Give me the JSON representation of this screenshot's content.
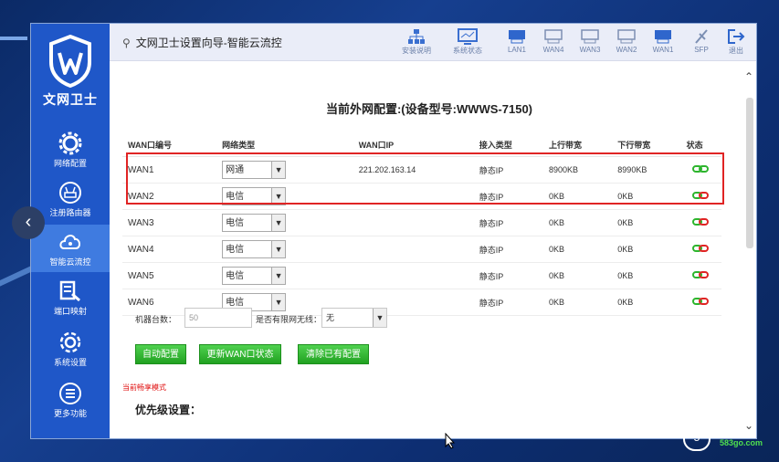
{
  "sidebar": {
    "logo_text": "文网卫士",
    "items": [
      {
        "label": "网络配置",
        "icon": "gear-icon"
      },
      {
        "label": "注册路由器",
        "icon": "router-icon"
      },
      {
        "label": "智能云流控",
        "icon": "cloud-icon"
      },
      {
        "label": "端口映射",
        "icon": "port-map-icon"
      },
      {
        "label": "系统设置",
        "icon": "settings-icon"
      },
      {
        "label": "更多功能",
        "icon": "menu-icon"
      }
    ]
  },
  "header": {
    "title": "文网卫士设置向导-智能云流控",
    "tools": [
      {
        "label": "安装说明",
        "icon": "network-icon"
      },
      {
        "label": "系统状态",
        "icon": "monitor-icon"
      },
      {
        "label": "LAN1",
        "icon": "lan-icon"
      },
      {
        "label": "WAN4",
        "icon": "wan-icon"
      },
      {
        "label": "WAN3",
        "icon": "wan-icon"
      },
      {
        "label": "WAN2",
        "icon": "wan-icon"
      },
      {
        "label": "WAN1",
        "icon": "lan-icon"
      },
      {
        "label": "SFP",
        "icon": "sfp-icon"
      },
      {
        "label": "退出",
        "icon": "logout-icon"
      }
    ]
  },
  "main": {
    "heading": "当前外网配置:(设备型号:WWWS-7150)",
    "table": {
      "headers": [
        "WAN口编号",
        "网络类型",
        "WAN口IP",
        "接入类型",
        "上行带宽",
        "下行带宽",
        "状态"
      ],
      "rows": [
        {
          "wan": "WAN1",
          "type": "网通",
          "ip": "221.202.163.14",
          "access": "静态IP",
          "up": "8900KB",
          "down": "8990KB",
          "status": "connected"
        },
        {
          "wan": "WAN2",
          "type": "电信",
          "ip": "",
          "access": "静态IP",
          "up": "0KB",
          "down": "0KB",
          "status": "disconnected"
        },
        {
          "wan": "WAN3",
          "type": "电信",
          "ip": "",
          "access": "静态IP",
          "up": "0KB",
          "down": "0KB",
          "status": "disconnected"
        },
        {
          "wan": "WAN4",
          "type": "电信",
          "ip": "",
          "access": "静态IP",
          "up": "0KB",
          "down": "0KB",
          "status": "disconnected"
        },
        {
          "wan": "WAN5",
          "type": "电信",
          "ip": "",
          "access": "静态IP",
          "up": "0KB",
          "down": "0KB",
          "status": "disconnected"
        },
        {
          "wan": "WAN6",
          "type": "电信",
          "ip": "",
          "access": "静态IP",
          "up": "0KB",
          "down": "0KB",
          "status": "disconnected"
        }
      ]
    },
    "machine_count_label": "机器台数：",
    "machine_count_value": "50",
    "wireless_label": "是否有限网无线：",
    "wireless_value": "无",
    "buttons": {
      "auto_config": "自动配置",
      "update_wan": "更新WAN口状态",
      "clear_config": "清除已有配置"
    },
    "mode_text": "当前畅享模式",
    "priority_title": "优先级设置："
  },
  "watermark": {
    "text": "国",
    "url": "583go.com",
    "badge": "5"
  },
  "colors": {
    "sidebar": "#1f57c8",
    "active": "#3f7be0",
    "button": "#2db52d",
    "highlight": "#e02424"
  }
}
